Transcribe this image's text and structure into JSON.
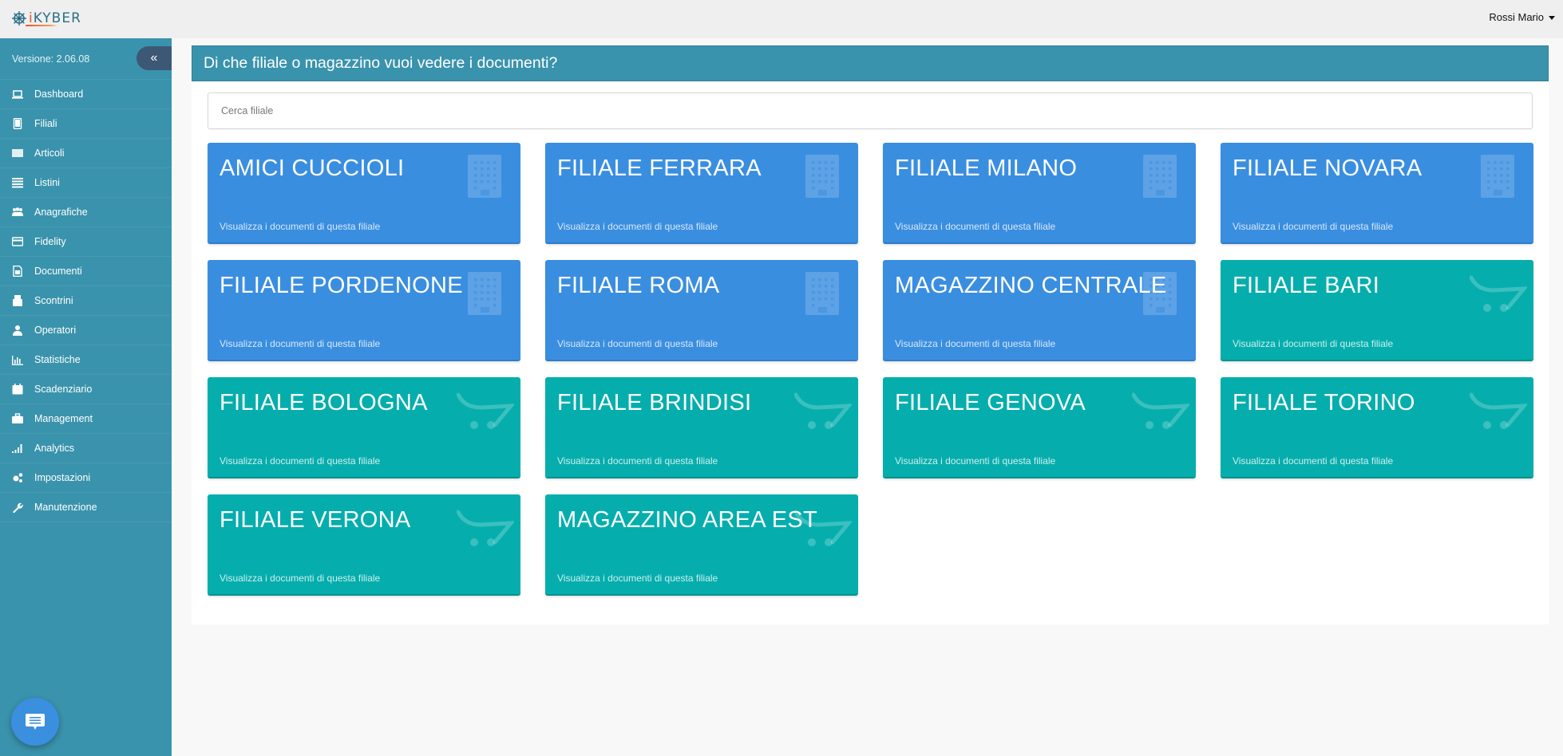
{
  "topbar": {
    "logo_text_prefix": "",
    "logo_i": "i",
    "logo_text": "KYBER",
    "user_name": "Rossi Mario"
  },
  "sidebar": {
    "version": "Versione: 2.06.08",
    "collapse_icon": "«",
    "items": [
      {
        "label": "Dashboard",
        "icon": "laptop-icon"
      },
      {
        "label": "Filiali",
        "icon": "tablet-icon"
      },
      {
        "label": "Articoli",
        "icon": "barcode-icon"
      },
      {
        "label": "Listini",
        "icon": "list-icon"
      },
      {
        "label": "Anagrafiche",
        "icon": "users-icon"
      },
      {
        "label": "Fidelity",
        "icon": "credit-card-icon"
      },
      {
        "label": "Documenti",
        "icon": "document-icon"
      },
      {
        "label": "Scontrini",
        "icon": "receipt-printer-icon"
      },
      {
        "label": "Operatori",
        "icon": "user-icon"
      },
      {
        "label": "Statistiche",
        "icon": "bar-chart-icon"
      },
      {
        "label": "Scadenziario",
        "icon": "calendar-icon"
      },
      {
        "label": "Management",
        "icon": "briefcase-icon"
      },
      {
        "label": "Analytics",
        "icon": "signal-icon"
      },
      {
        "label": "Impostazioni",
        "icon": "cogs-icon"
      },
      {
        "label": "Manutenzione",
        "icon": "wrench-icon"
      }
    ]
  },
  "main": {
    "title": "Di che filiale o magazzino vuoi vedere i documenti?",
    "search_placeholder": "Cerca filiale",
    "search_value": "",
    "tile_subtitle": "Visualizza i documenti di questa filiale",
    "colors": {
      "blue": "#3a8ee0",
      "teal": "#05aead",
      "header": "#3a93ac"
    },
    "tiles": [
      {
        "name": "AMICI CUCCIOLI",
        "type": "blue",
        "icon": "building-icon"
      },
      {
        "name": "FILIALE FERRARA",
        "type": "blue",
        "icon": "building-icon"
      },
      {
        "name": "FILIALE MILANO",
        "type": "blue",
        "icon": "building-icon"
      },
      {
        "name": "FILIALE NOVARA",
        "type": "blue",
        "icon": "building-icon"
      },
      {
        "name": "FILIALE PORDENONE",
        "type": "blue",
        "icon": "building-icon"
      },
      {
        "name": "FILIALE ROMA",
        "type": "blue",
        "icon": "building-icon"
      },
      {
        "name": "MAGAZZINO CENTRALE",
        "type": "blue",
        "icon": "building-icon"
      },
      {
        "name": "FILIALE BARI",
        "type": "teal",
        "icon": "shopping-cart-icon"
      },
      {
        "name": "FILIALE BOLOGNA",
        "type": "teal",
        "icon": "shopping-cart-icon"
      },
      {
        "name": "FILIALE BRINDISI",
        "type": "teal",
        "icon": "shopping-cart-icon"
      },
      {
        "name": "FILIALE GENOVA",
        "type": "teal",
        "icon": "shopping-cart-icon"
      },
      {
        "name": "FILIALE TORINO",
        "type": "teal",
        "icon": "shopping-cart-icon"
      },
      {
        "name": "FILIALE VERONA",
        "type": "teal",
        "icon": "shopping-cart-icon"
      },
      {
        "name": "MAGAZZINO AREA EST",
        "type": "teal",
        "icon": "shopping-cart-icon"
      }
    ]
  },
  "chat": {
    "icon": "chat-icon"
  }
}
